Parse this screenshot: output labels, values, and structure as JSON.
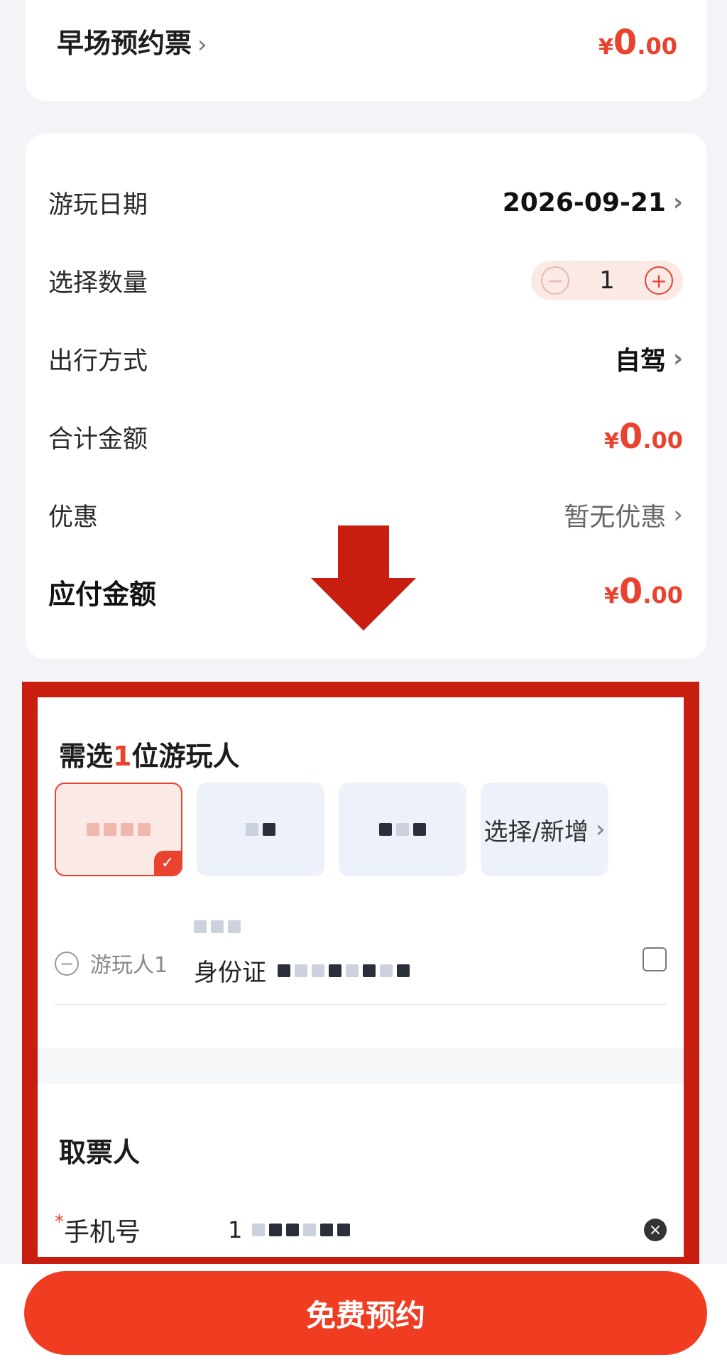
{
  "ticket": {
    "name": "早场预约票",
    "price": {
      "yen": "¥",
      "int": "0",
      "dec": ".00"
    }
  },
  "rows": [
    {
      "label": "游玩日期",
      "value": "2026-09-21"
    },
    {
      "label": "选择数量",
      "value": "1"
    },
    {
      "label": "出行方式",
      "value": "自驾"
    },
    {
      "label": "合计金额",
      "price": {
        "yen": "¥",
        "int": "0",
        "dec": ".00"
      }
    },
    {
      "label": "优惠",
      "value": "暂无优惠"
    },
    {
      "label": "应付金额",
      "price": {
        "yen": "¥",
        "int": "0",
        "dec": ".00"
      }
    }
  ],
  "visitors": {
    "title_prefix": "需选",
    "count": "1",
    "title_suffix": "位游玩人",
    "add_label": "选择/新增",
    "item_label": "游玩人1",
    "id_type": "身份证"
  },
  "pickup": {
    "title": "取票人",
    "required_mark": "*",
    "phone_label": "手机号",
    "phone_prefix": "1"
  },
  "cta": {
    "label": "免费预约"
  },
  "colors": {
    "accent": "#e9432f",
    "highlight": "#c71e10",
    "cta": "#f03d22"
  }
}
